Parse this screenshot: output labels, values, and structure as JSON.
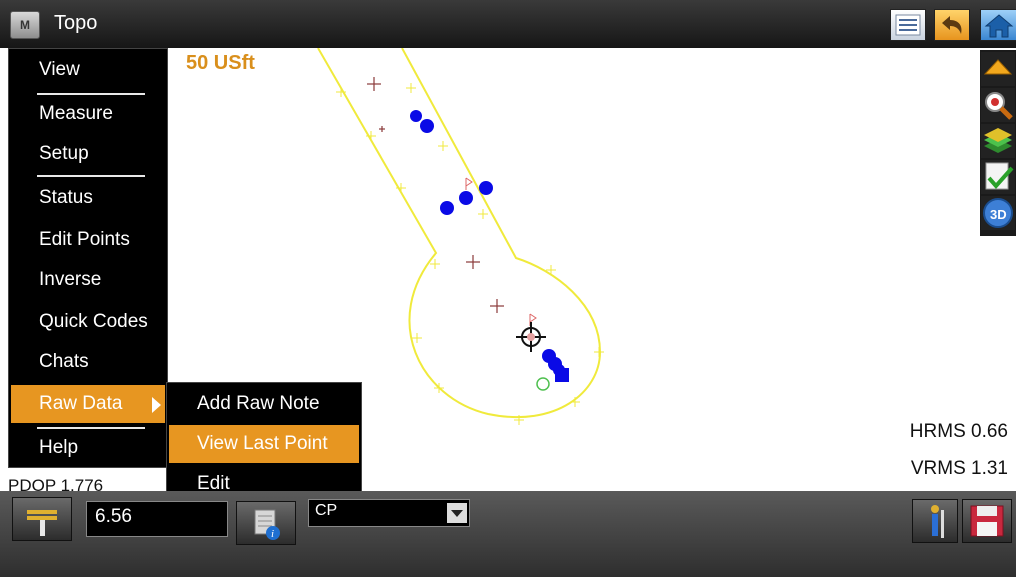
{
  "app": {
    "logo_letter": "M",
    "title": "Topo"
  },
  "toolbar": {
    "icons": [
      "list-icon",
      "undo-icon",
      "home-icon"
    ]
  },
  "map": {
    "scale_label": "50 USft",
    "hrms": "HRMS 0.66",
    "vrms": "VRMS 1.31",
    "pdop_partial": "PDOP 1.776"
  },
  "right_toolbar": {
    "icons": [
      "pan-up-icon",
      "zoom-icon",
      "layers-icon",
      "check-icon",
      "3d-view-icon"
    ]
  },
  "main_menu": {
    "items": [
      {
        "label": "View"
      },
      {
        "label": "Measure"
      },
      {
        "label": "Setup"
      },
      {
        "label": "Status"
      },
      {
        "label": "Edit Points"
      },
      {
        "label": "Inverse"
      },
      {
        "label": "Quick Codes"
      },
      {
        "label": "Chats"
      },
      {
        "label": "Raw Data"
      },
      {
        "label": "Help"
      }
    ],
    "active_item": "Raw Data"
  },
  "submenu": {
    "items": [
      {
        "label": "Add Raw Note"
      },
      {
        "label": "View Last Point"
      },
      {
        "label": "Edit"
      }
    ],
    "highlighted_item": "View Last Point"
  },
  "bottom_bar": {
    "height_value": "6.56",
    "code_value": "CP"
  },
  "colors": {
    "accent": "#e79621",
    "scale_text": "#d98f1c",
    "boundary": "#f0ea3c",
    "points": "#0a0ae6",
    "crosses": "#8a3a3a"
  }
}
